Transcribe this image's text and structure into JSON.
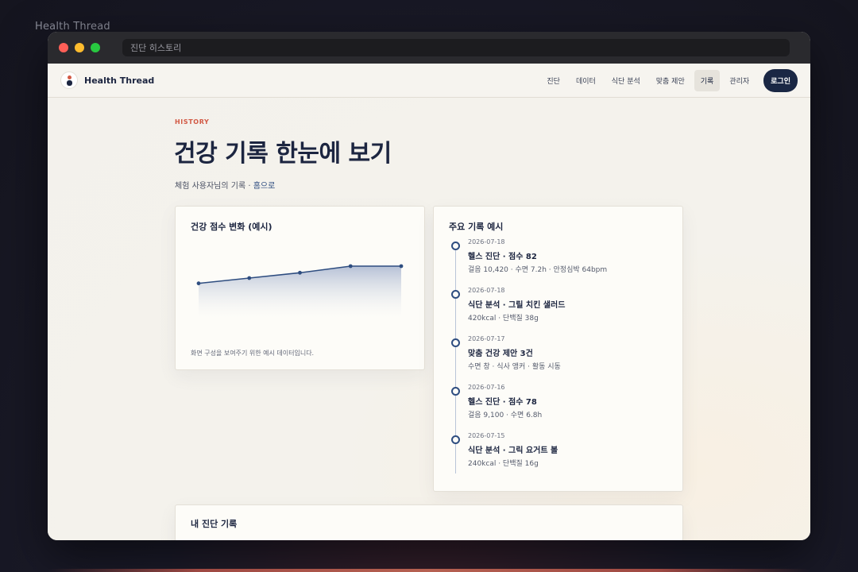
{
  "desktop": {
    "app_label": "Health Thread"
  },
  "window": {
    "url": "진단 히스토리"
  },
  "navbar": {
    "brand": "Health Thread",
    "links": [
      "진단",
      "데이터",
      "식단 분석",
      "맞춤 제안",
      "기록",
      "관리자"
    ],
    "active_link": "기록",
    "login_label": "로그인"
  },
  "header": {
    "eyebrow": "HISTORY",
    "title": "건강 기록 한눈에 보기",
    "subline_prefix": "체험 사용자님의 기록 · ",
    "home_link": "홈으로"
  },
  "chart_card": {
    "title": "건강 점수 변화 (예시)",
    "note": "화면 구성을 보여주기 위한 예시 데이터입니다."
  },
  "chart_data": {
    "type": "area",
    "x": [
      1,
      2,
      3,
      4,
      5
    ],
    "values": [
      66,
      70,
      74,
      79,
      79
    ],
    "ylim": [
      40,
      100
    ],
    "title": "건강 점수 변화 (예시)",
    "xlabel": "",
    "ylabel": "",
    "grid": false,
    "colors": {
      "line": "#2e4d80",
      "fill_top": "#a9b6d0",
      "fill_bottom": "#fdfcf8"
    }
  },
  "records_card": {
    "title": "주요 기록 예시",
    "items": [
      {
        "date": "2026-07-18",
        "title": "헬스 진단 · 점수 82",
        "detail": "걸음 10,420 · 수면 7.2h · 안정심박 64bpm"
      },
      {
        "date": "2026-07-18",
        "title": "식단 분석 · 그릴 치킨 샐러드",
        "detail": "420kcal · 단백질 38g"
      },
      {
        "date": "2026-07-17",
        "title": "맞춤 건강 제안 3건",
        "detail": "수면 창 · 식사 앵커 · 활동 시동"
      },
      {
        "date": "2026-07-16",
        "title": "헬스 진단 · 점수 78",
        "detail": "걸음 9,100 · 수면 6.8h"
      },
      {
        "date": "2026-07-15",
        "title": "식단 분석 · 그릭 요거트 볼",
        "detail": "240kcal · 단백질 16g"
      }
    ]
  },
  "history_card": {
    "title": "내 진단 기록"
  }
}
